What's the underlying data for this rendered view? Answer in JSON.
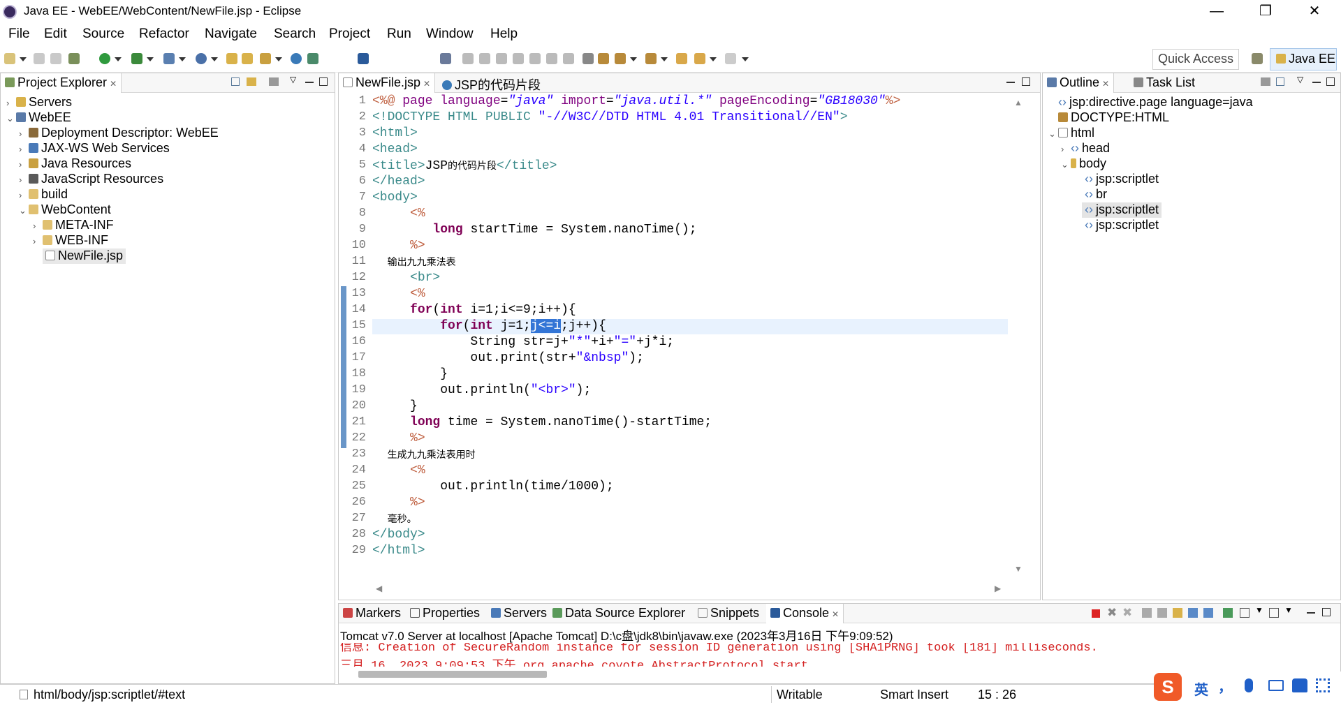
{
  "window": {
    "title": "Java EE - WebEE/WebContent/NewFile.jsp - Eclipse",
    "min": "—",
    "max": "❐",
    "close": "✕"
  },
  "menu": [
    "File",
    "Edit",
    "Source",
    "Refactor",
    "Navigate",
    "Search",
    "Project",
    "Run",
    "Window",
    "Help"
  ],
  "toolbar": {
    "quick_access": "Quick Access",
    "perspective": "Java EE"
  },
  "project_explorer": {
    "tab": "Project Explorer",
    "items": [
      "Servers",
      "WebEE",
      "Deployment Descriptor: WebEE",
      "JAX-WS Web Services",
      "Java Resources",
      "JavaScript Resources",
      "build",
      "WebContent",
      "META-INF",
      "WEB-INF",
      "NewFile.jsp"
    ]
  },
  "editor": {
    "tabs": [
      "NewFile.jsp",
      "JSP的代码片段"
    ],
    "line_numbers": [
      "1",
      "2",
      "3",
      "4",
      "5",
      "6",
      "7",
      "8",
      "9",
      "10",
      "11",
      "12",
      "13",
      "14",
      "15",
      "16",
      "17",
      "18",
      "19",
      "20",
      "21",
      "22",
      "23",
      "24",
      "25",
      "26",
      "27",
      "28",
      "29"
    ]
  },
  "outline": {
    "tabs": [
      "Outline",
      "Task List"
    ],
    "items": [
      "jsp:directive.page language=java",
      "DOCTYPE:HTML",
      "html",
      "head",
      "body",
      "jsp:scriptlet",
      "br",
      "jsp:scriptlet",
      "jsp:scriptlet"
    ]
  },
  "bottom": {
    "tabs": [
      "Markers",
      "Properties",
      "Servers",
      "Data Source Explorer",
      "Snippets",
      "Console"
    ],
    "server_line": "Tomcat v7.0 Server at localhost [Apache Tomcat] D:\\c盘\\jdk8\\bin\\javaw.exe (2023年3月16日 下午9:09:52)",
    "log1": "信息: Creation of SecureRandom instance for session ID generation using [SHA1PRNG] took [181] milliseconds.",
    "log2": "三月 16, 2023 9:09:53 下午 org.apache.coyote.AbstractProtocol start"
  },
  "status": {
    "path": "html/body/jsp:scriptlet/#text",
    "writable": "Writable",
    "insert": "Smart Insert",
    "position": "15 : 26"
  },
  "ime": {
    "lang": "英",
    "punct": "，"
  }
}
